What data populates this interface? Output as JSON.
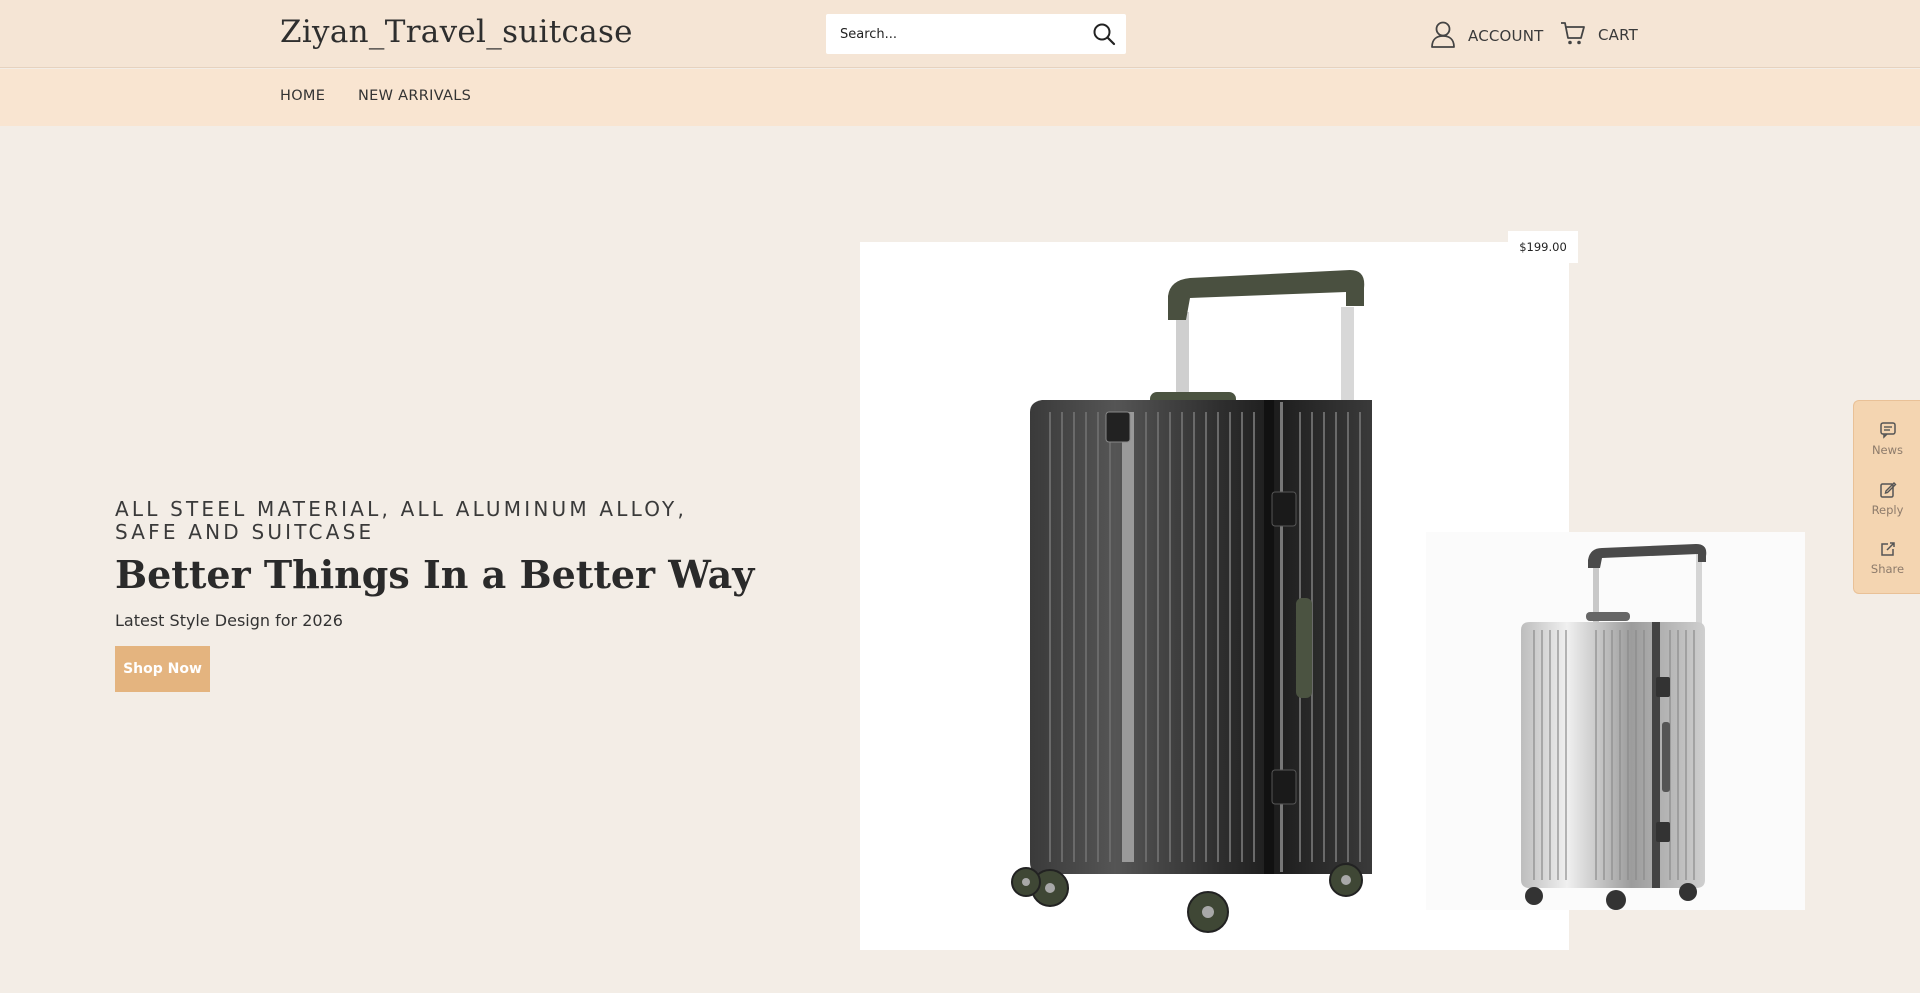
{
  "header": {
    "logo": "Ziyan_Travel_suitcase",
    "search_placeholder": "Search...",
    "account_label": "ACCOUNT",
    "cart_label": "CART"
  },
  "nav": {
    "items": [
      {
        "label": "HOME"
      },
      {
        "label": "NEW ARRIVALS"
      }
    ]
  },
  "hero": {
    "eyebrow": "ALL STEEL MATERIAL, ALL ALUMINUM ALLOY, SAFE AND SUITCASE",
    "headline": "Better Things In a Better Way",
    "subline": "Latest Style Design for 2026",
    "button_label": "Shop Now",
    "price": "$199.00"
  },
  "widget": {
    "items": [
      {
        "label": "News",
        "icon": "chat-icon"
      },
      {
        "label": "Reply",
        "icon": "edit-icon"
      },
      {
        "label": "Share",
        "icon": "share-icon"
      }
    ]
  },
  "colors": {
    "header_bg": "#f5e5d5",
    "nav_bg": "#f9e5d1",
    "page_bg": "#f3ede6",
    "accent": "#e4b47f",
    "widget_bg": "#f4d5b1"
  }
}
